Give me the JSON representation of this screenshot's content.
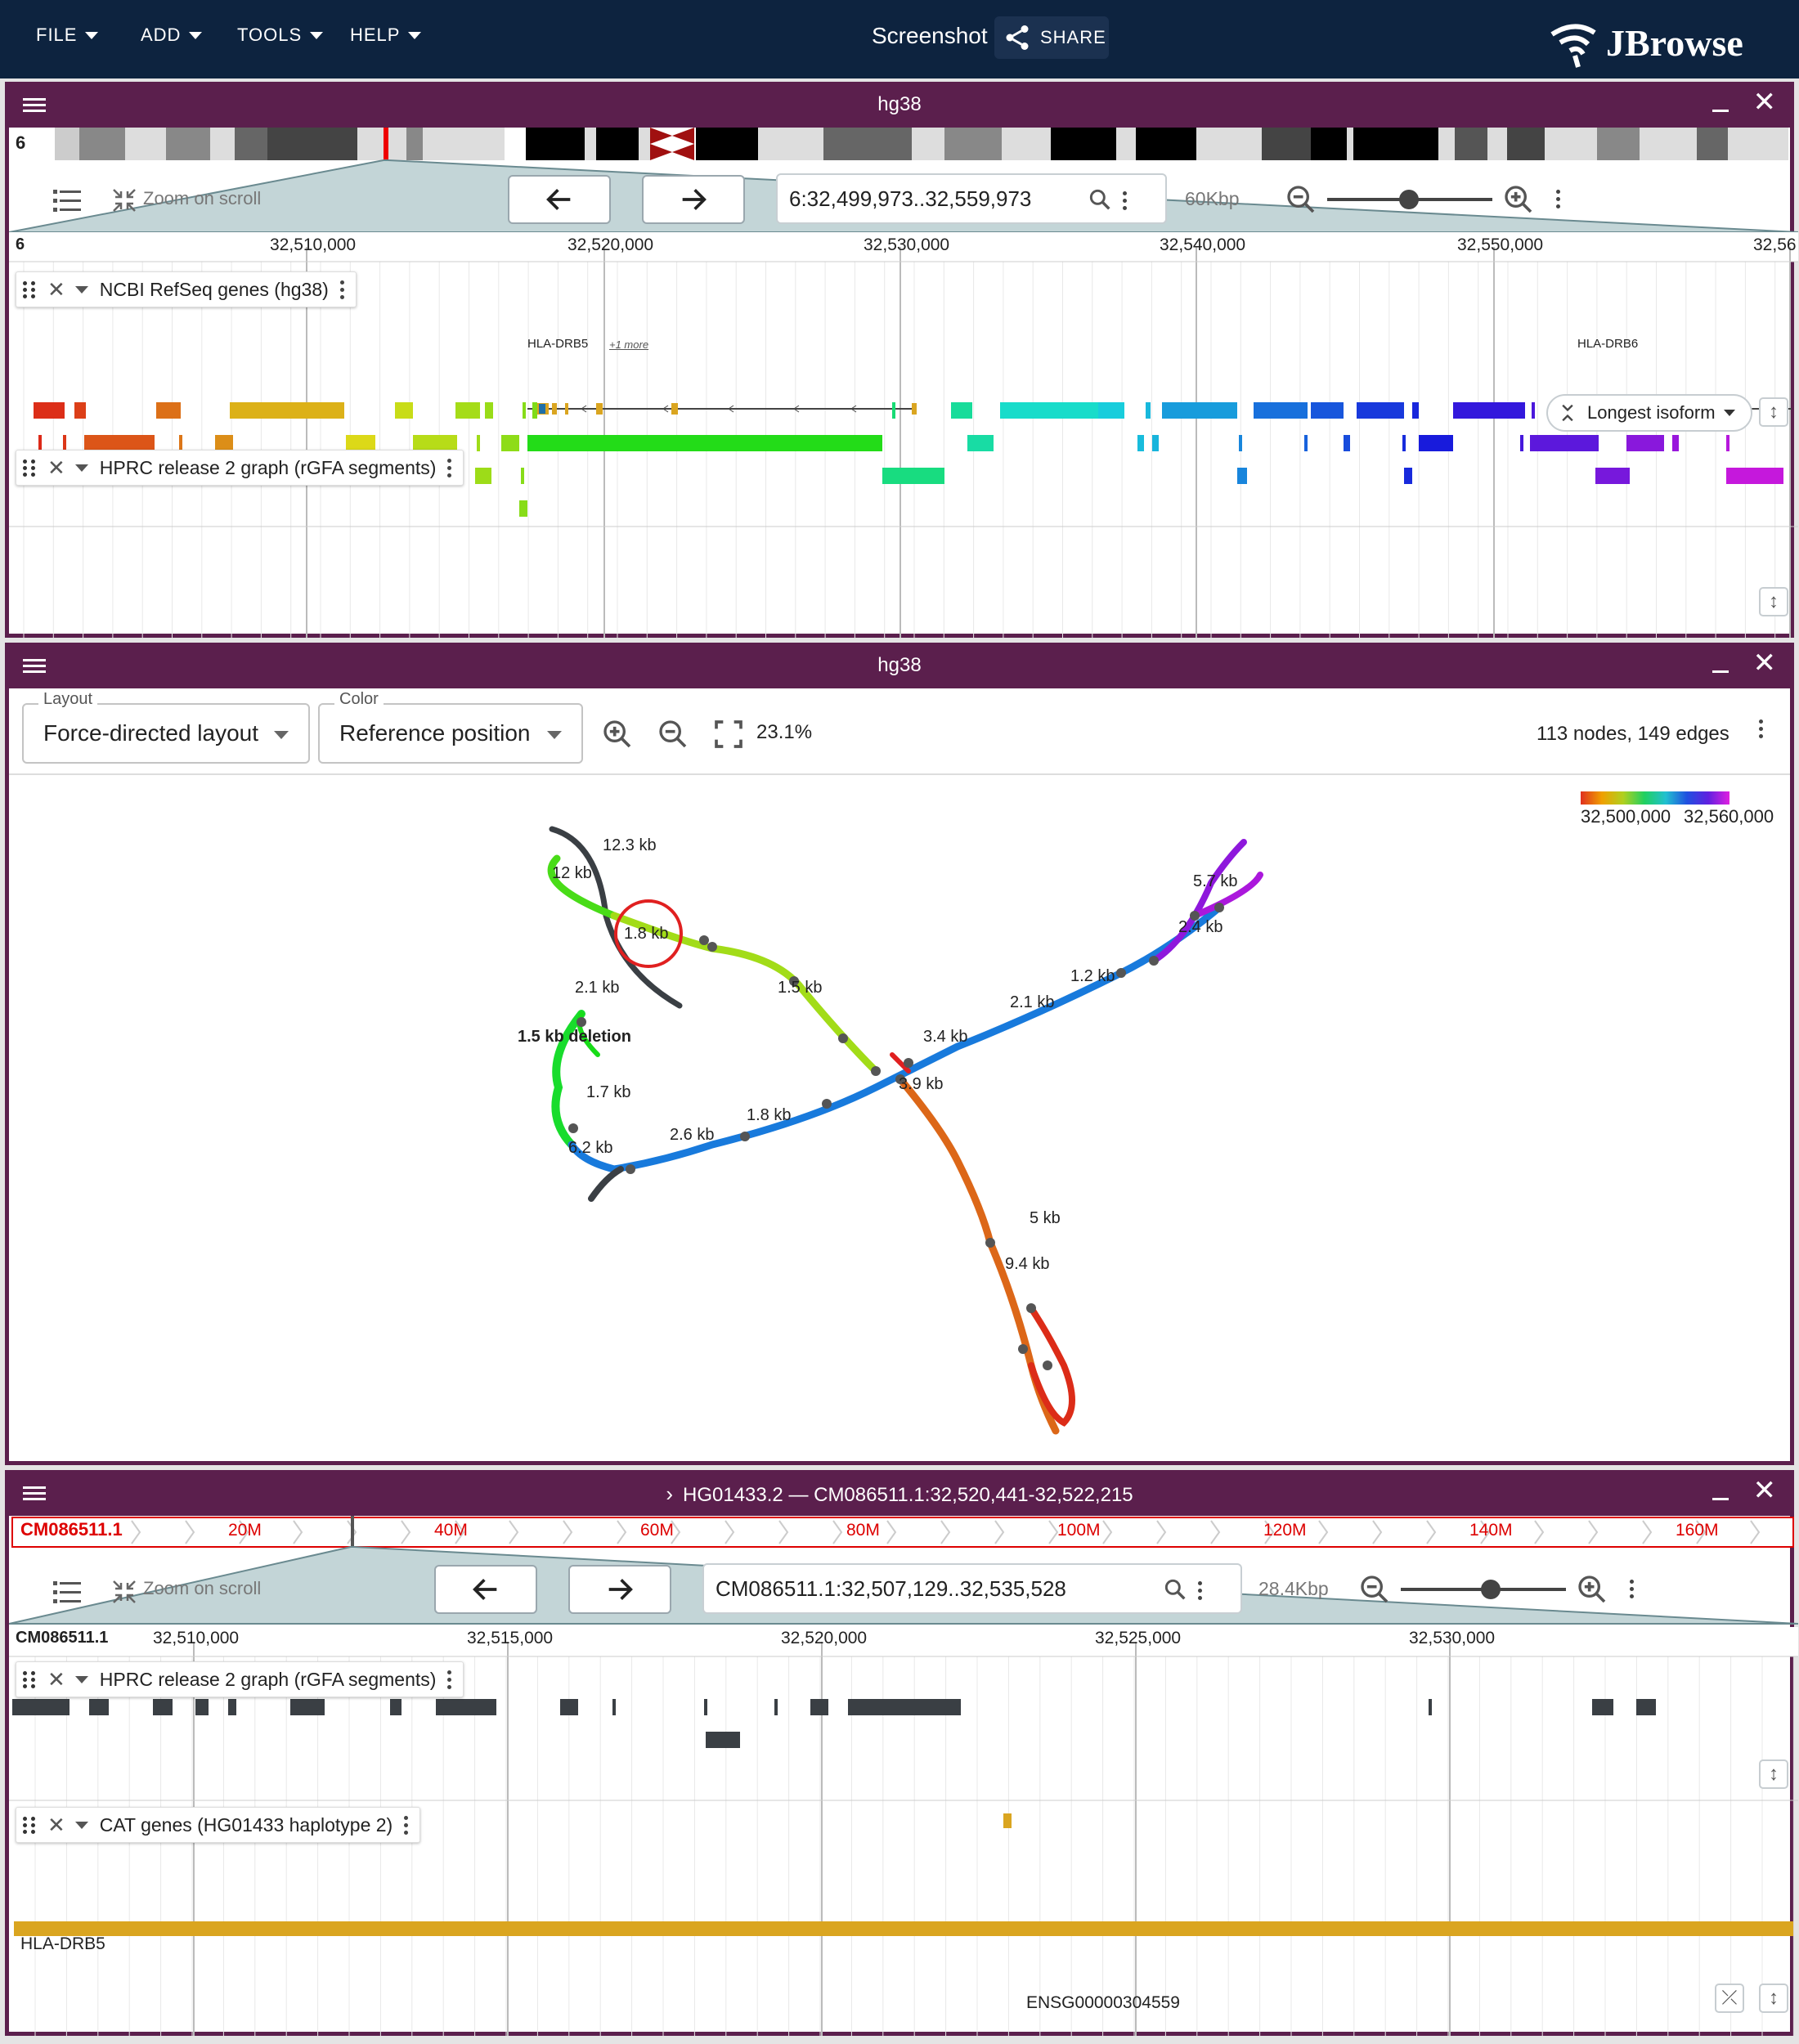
{
  "appbar": {
    "menus": [
      "FILE",
      "ADD",
      "TOOLS",
      "HELP"
    ],
    "session_name": "Screenshot",
    "share_label": "SHARE",
    "logo_text": "JBrowse"
  },
  "view1": {
    "title": "hg38",
    "chromosome": "6",
    "zoom_label": "Zoom on scroll",
    "locstring": "6:32,499,973..32,559,973",
    "span": "60Kbp",
    "ruler_ref": "6",
    "ruler_ticks": [
      "32,510,000",
      "32,520,000",
      "32,530,000",
      "32,540,000",
      "32,550,000",
      "32,56"
    ],
    "tracks": [
      {
        "name": "NCBI RefSeq genes (hg38)"
      },
      {
        "name": "HPRC release 2 graph (rGFA segments)"
      }
    ],
    "genes": [
      {
        "name": "HLA-DRB5",
        "more": "+1 more"
      },
      {
        "name": "HLA-DRB6"
      }
    ],
    "isoform_label": "Longest isoform"
  },
  "view2": {
    "title": "hg38",
    "layout_label": "Layout",
    "layout_value": "Force-directed layout",
    "color_label": "Color",
    "color_value": "Reference position",
    "zoom_pct": "23.1%",
    "stats": "113 nodes, 149 edges",
    "legend_min": "32,500,000",
    "legend_max": "32,560,000",
    "graph_labels": [
      "12.3 kb",
      "12 kb",
      "1.8 kb",
      "2.1 kb",
      "1.5 kb deletion",
      "1.7 kb",
      "6.2 kb",
      "2.6 kb",
      "1.8 kb",
      "1.5 kb",
      "3.4 kb",
      "3.9 kb",
      "2.1 kb",
      "1.2 kb",
      "2.4 kb",
      "5.7 kb",
      "5 kb",
      "9.4 kb"
    ]
  },
  "view3": {
    "title": "HG01433.2 — CM086511.1:32,520,441-32,522,215",
    "chrom_name": "CM086511.1",
    "overview_ticks": [
      "20M",
      "40M",
      "60M",
      "80M",
      "100M",
      "120M",
      "140M",
      "160M"
    ],
    "zoom_label": "Zoom on scroll",
    "locstring": "CM086511.1:32,507,129..32,535,528",
    "span": "28.4Kbp",
    "ruler_ref": "CM086511.1",
    "ruler_ticks": [
      "32,510,000",
      "32,515,000",
      "32,520,000",
      "32,525,000",
      "32,530,000"
    ],
    "tracks": [
      {
        "name": "HPRC release 2 graph (rGFA segments)"
      },
      {
        "name": "CAT genes (HG01433 haplotype 2)"
      }
    ],
    "genes": [
      {
        "name": "HLA-DRB5"
      },
      {
        "name": "ENSG00000304559"
      }
    ]
  },
  "colors": {
    "appbar": "#0d233f",
    "view_header": "#5b1f4d",
    "gene": "#daa520",
    "segment_gray": "#3a3f44"
  }
}
